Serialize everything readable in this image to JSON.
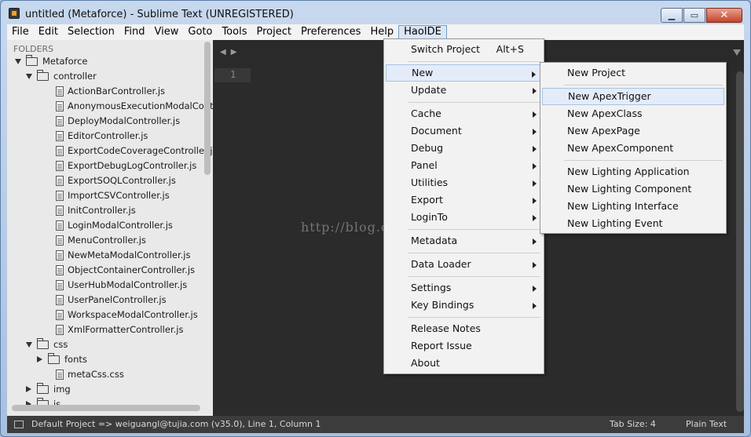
{
  "window": {
    "title": "untitled (Metaforce) - Sublime Text (UNREGISTERED)",
    "minimize_glyph": "▁",
    "maximize_glyph": "▭",
    "close_glyph": "✕"
  },
  "menubar": [
    "File",
    "Edit",
    "Selection",
    "Find",
    "View",
    "Goto",
    "Tools",
    "Project",
    "Preferences",
    "Help",
    "HaoIDE"
  ],
  "sidebar": {
    "header": "FOLDERS",
    "tree": [
      {
        "label": "Metaforce",
        "type": "folder",
        "depth": 0,
        "state": "open"
      },
      {
        "label": "controller",
        "type": "folder",
        "depth": 1,
        "state": "open"
      },
      {
        "label": "ActionBarController.js",
        "type": "file",
        "depth": 2
      },
      {
        "label": "AnonymousExecutionModalController.js",
        "type": "file",
        "depth": 2
      },
      {
        "label": "DeployModalController.js",
        "type": "file",
        "depth": 2
      },
      {
        "label": "EditorController.js",
        "type": "file",
        "depth": 2
      },
      {
        "label": "ExportCodeCoverageController.js",
        "type": "file",
        "depth": 2
      },
      {
        "label": "ExportDebugLogController.js",
        "type": "file",
        "depth": 2
      },
      {
        "label": "ExportSOQLController.js",
        "type": "file",
        "depth": 2
      },
      {
        "label": "ImportCSVController.js",
        "type": "file",
        "depth": 2
      },
      {
        "label": "InitController.js",
        "type": "file",
        "depth": 2
      },
      {
        "label": "LoginModalController.js",
        "type": "file",
        "depth": 2
      },
      {
        "label": "MenuController.js",
        "type": "file",
        "depth": 2
      },
      {
        "label": "NewMetaModalController.js",
        "type": "file",
        "depth": 2
      },
      {
        "label": "ObjectContainerController.js",
        "type": "file",
        "depth": 2
      },
      {
        "label": "UserHubModalController.js",
        "type": "file",
        "depth": 2
      },
      {
        "label": "UserPanelController.js",
        "type": "file",
        "depth": 2
      },
      {
        "label": "WorkspaceModalController.js",
        "type": "file",
        "depth": 2
      },
      {
        "label": "XmlFormatterController.js",
        "type": "file",
        "depth": 2
      },
      {
        "label": "css",
        "type": "folder",
        "depth": 1,
        "state": "open"
      },
      {
        "label": "fonts",
        "type": "folder",
        "depth": 2,
        "state": "closed"
      },
      {
        "label": "metaCss.css",
        "type": "file",
        "depth": 2
      },
      {
        "label": "img",
        "type": "folder",
        "depth": 1,
        "state": "closed"
      },
      {
        "label": "js",
        "type": "folder",
        "depth": 1,
        "state": "closed"
      }
    ]
  },
  "editor": {
    "line_number": "1",
    "watermark": "http://blog.csdn.net/"
  },
  "haoide_menu": {
    "items": [
      {
        "label": "Switch Project",
        "accel": "Alt+S",
        "submenu": false
      },
      {
        "sep": true
      },
      {
        "label": "New",
        "submenu": true,
        "highlighted": true
      },
      {
        "label": "Update",
        "submenu": true
      },
      {
        "sep": true
      },
      {
        "label": "Cache",
        "submenu": true
      },
      {
        "label": "Document",
        "submenu": true
      },
      {
        "label": "Debug",
        "submenu": true
      },
      {
        "label": "Panel",
        "submenu": true
      },
      {
        "label": "Utilities",
        "submenu": true
      },
      {
        "label": "Export",
        "submenu": true
      },
      {
        "label": "LoginTo",
        "submenu": true
      },
      {
        "sep": true
      },
      {
        "label": "Metadata",
        "submenu": true
      },
      {
        "sep": true
      },
      {
        "label": "Data Loader",
        "submenu": true
      },
      {
        "sep": true
      },
      {
        "label": "Settings",
        "submenu": true
      },
      {
        "label": "Key Bindings",
        "submenu": true
      },
      {
        "sep": true
      },
      {
        "label": "Release Notes",
        "submenu": false
      },
      {
        "label": "Report Issue",
        "submenu": false
      },
      {
        "label": "About",
        "submenu": false
      }
    ]
  },
  "new_submenu": {
    "items": [
      {
        "label": "New Project"
      },
      {
        "sep": true
      },
      {
        "label": "New ApexTrigger",
        "highlighted": true
      },
      {
        "label": "New ApexClass"
      },
      {
        "label": "New ApexPage"
      },
      {
        "label": "New ApexComponent"
      },
      {
        "sep": true
      },
      {
        "label": "New Lighting Application"
      },
      {
        "label": "New Lighting Component"
      },
      {
        "label": "New Lighting Interface"
      },
      {
        "label": "New Lighting Event"
      }
    ]
  },
  "status": {
    "text": "Default Project => weiguangl@tujia.com (v35.0), Line 1, Column 1",
    "tab_size": "Tab Size: 4",
    "syntax": "Plain Text"
  }
}
